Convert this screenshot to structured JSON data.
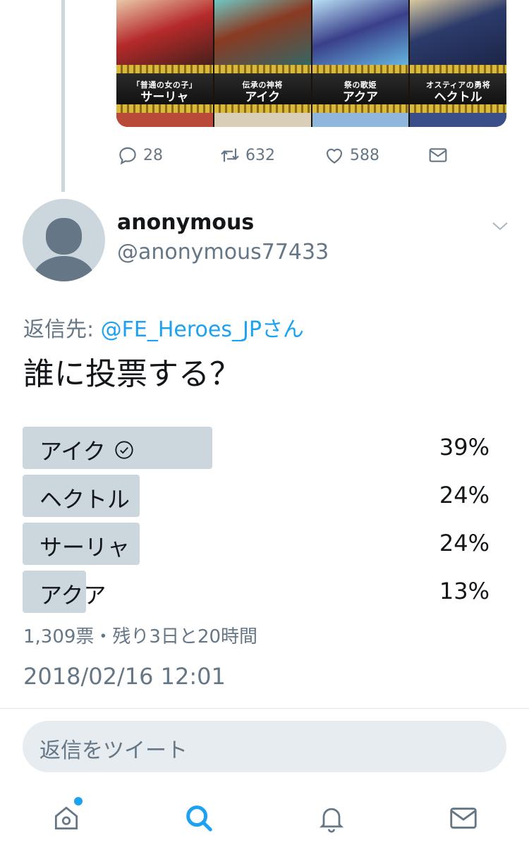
{
  "previous_tweet": {
    "cards": [
      {
        "subtitle": "「普通の女の子」",
        "name": "サーリャ"
      },
      {
        "subtitle": "伝承の神将",
        "name": "アイク"
      },
      {
        "subtitle": "祭の歌姫",
        "name": "アクア"
      },
      {
        "subtitle": "オスティアの勇将",
        "name": "ヘクトル"
      }
    ],
    "actions": {
      "reply_count": "28",
      "retweet_count": "632",
      "like_count": "588"
    }
  },
  "tweet": {
    "display_name": "anonymous",
    "handle": "@anonymous77433",
    "reply_prefix": "返信先: ",
    "reply_mention": "@FE_Heroes_JPさん",
    "text": "誰に投票する？",
    "poll": {
      "options": [
        {
          "label": "アイク",
          "percent": "39%",
          "fraction": 0.39,
          "selected": true
        },
        {
          "label": "ヘクトル",
          "percent": "24%",
          "fraction": 0.24,
          "selected": false
        },
        {
          "label": "サーリャ",
          "percent": "24%",
          "fraction": 0.24,
          "selected": false
        },
        {
          "label": "アクア",
          "percent": "13%",
          "fraction": 0.13,
          "selected": false
        }
      ],
      "meta": "1,309票・残り3日と20時間"
    },
    "timestamp": "2018/02/16 12:01"
  },
  "reply_box": {
    "placeholder": "返信をツイート"
  },
  "colors": {
    "accent": "#1da1f2",
    "secondary_text": "#657786",
    "poll_bar": "#ccd6dd"
  },
  "tab_bar": {
    "icons": [
      "home-icon",
      "search-icon",
      "notifications-icon",
      "messages-icon"
    ]
  }
}
